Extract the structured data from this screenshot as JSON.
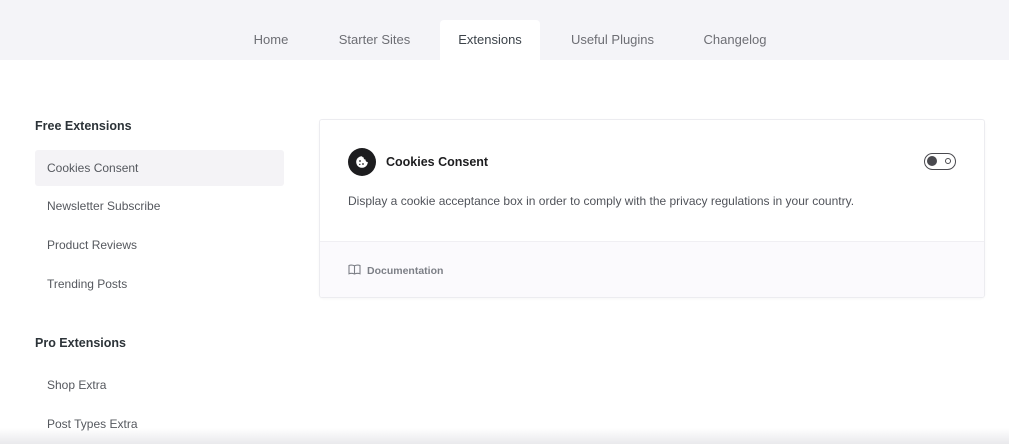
{
  "tabs": [
    {
      "label": "Home"
    },
    {
      "label": "Starter Sites"
    },
    {
      "label": "Extensions",
      "active": true
    },
    {
      "label": "Useful Plugins"
    },
    {
      "label": "Changelog"
    }
  ],
  "sidebar": {
    "free_title": "Free Extensions",
    "free_items": [
      {
        "label": "Cookies Consent",
        "active": true
      },
      {
        "label": "Newsletter Subscribe"
      },
      {
        "label": "Product Reviews"
      },
      {
        "label": "Trending Posts"
      }
    ],
    "pro_title": "Pro Extensions",
    "pro_items": [
      {
        "label": "Shop Extra"
      },
      {
        "label": "Post Types Extra"
      }
    ]
  },
  "card": {
    "icon": "cookie-icon",
    "title": "Cookies Consent",
    "toggle_state": "off",
    "description": "Display a cookie acceptance box in order to comply with the privacy regulations in your country.",
    "doc_icon": "book-icon",
    "doc_label": "Documentation"
  },
  "colors": {
    "tabbar_bg": "#f4f4f8",
    "active_item_bg": "#f4f3f6",
    "icon_bg": "#1d1d1f"
  }
}
